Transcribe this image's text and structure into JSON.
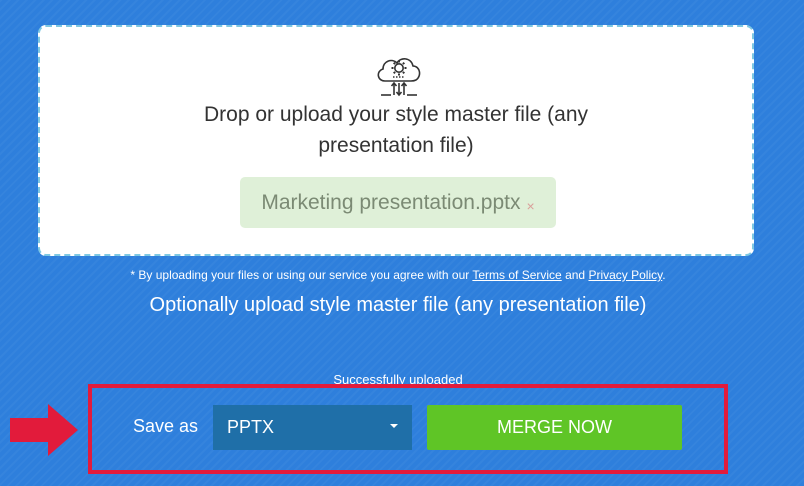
{
  "dropzone": {
    "icon": "cloud-gear-upload-icon",
    "line1": "Drop or upload your style master file (any",
    "line2": "presentation file)",
    "file_name": "Marketing presentation.pptx",
    "remove_icon": "×"
  },
  "terms": {
    "prefix": "* By uploading your files or using our service you agree with our",
    "tos": "Terms of Service",
    "and": "and",
    "privacy": "Privacy Policy",
    "suffix": "."
  },
  "optional_text": "Optionally upload style master file (any presentation file)",
  "status_text": "Successfully uploaded",
  "controls": {
    "save_as_label": "Save as",
    "format_selected": "PPTX",
    "merge_button": "MERGE NOW"
  },
  "colors": {
    "background": "#2e7fdc",
    "highlight": "#e21b3b",
    "merge_button": "#5fc526",
    "select": "#1f6fa8"
  },
  "annotations": {
    "arrow_icon": "red-arrow-icon"
  }
}
